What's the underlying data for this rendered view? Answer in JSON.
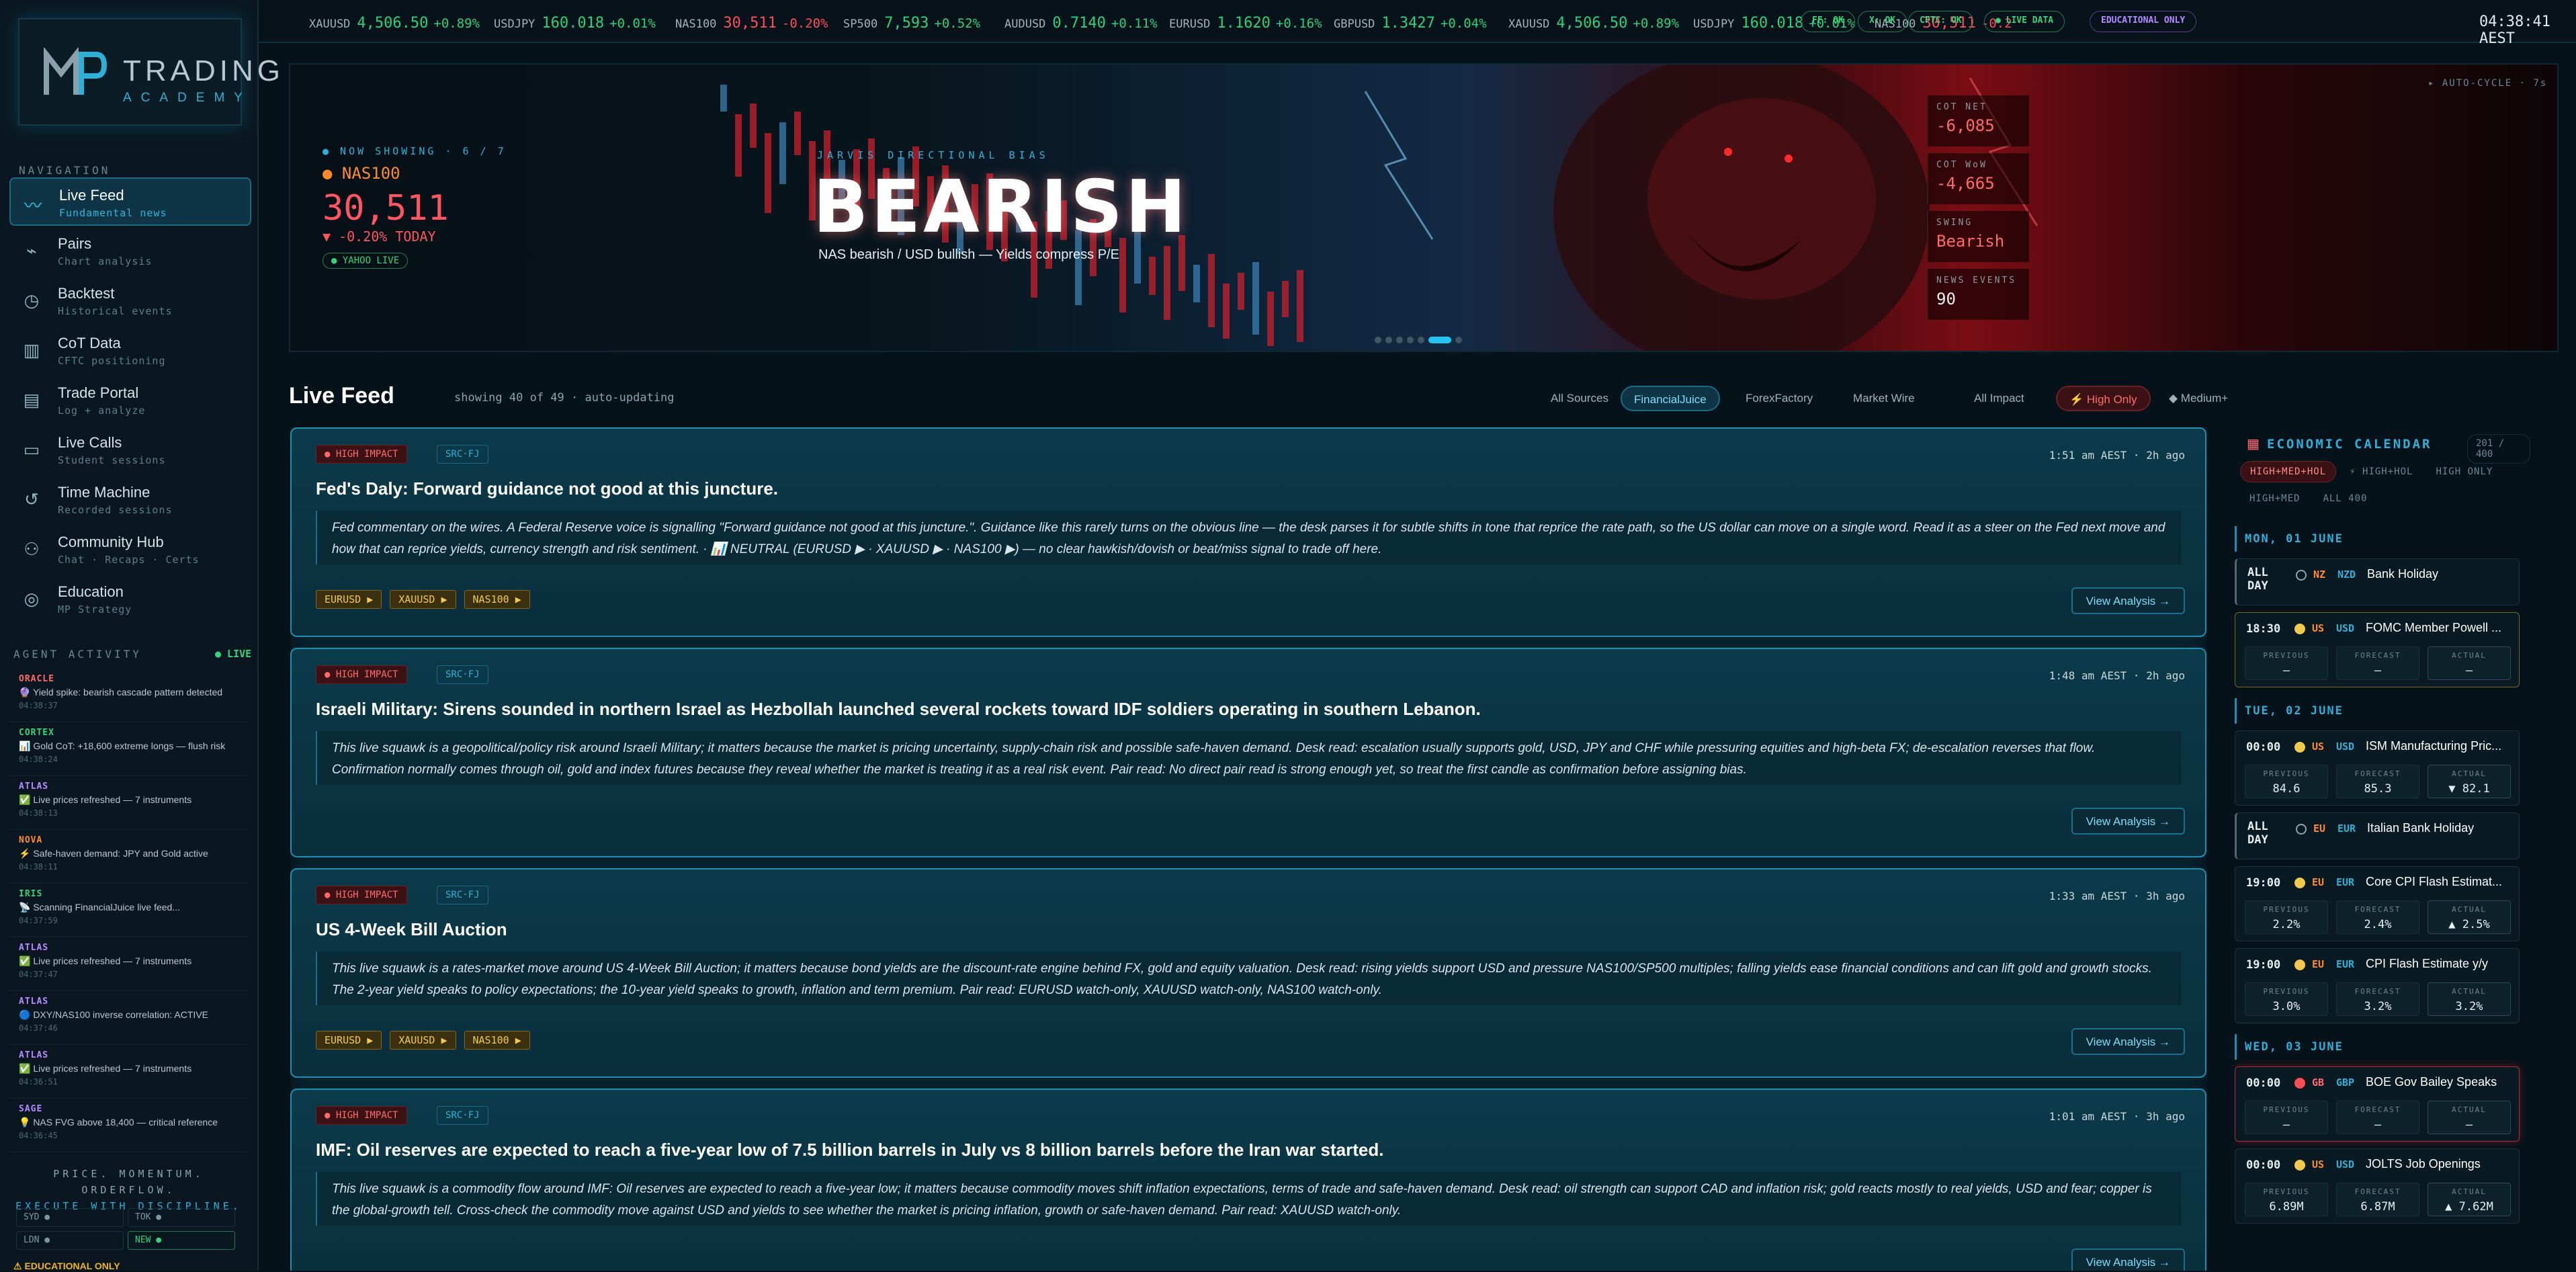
{
  "brand": {
    "name": "TRADING",
    "sub": "ACADEMY"
  },
  "nav": {
    "heading": "NAVIGATION",
    "items": [
      {
        "label": "Live Feed",
        "sub": "Fundamental news",
        "icon": "rss-icon",
        "glyph": "〰"
      },
      {
        "label": "Pairs",
        "sub": "Chart analysis",
        "icon": "chart-icon",
        "glyph": "⌁"
      },
      {
        "label": "Backtest",
        "sub": "Historical events",
        "icon": "clock-icon",
        "glyph": "◷"
      },
      {
        "label": "CoT Data",
        "sub": "CFTC positioning",
        "icon": "bar-chart-icon",
        "glyph": "▥"
      },
      {
        "label": "Trade Portal",
        "sub": "Log + analyze",
        "icon": "document-icon",
        "glyph": "▤"
      },
      {
        "label": "Live Calls",
        "sub": "Student sessions",
        "icon": "video-icon",
        "glyph": "▭"
      },
      {
        "label": "Time Machine",
        "sub": "Recorded sessions",
        "icon": "history-icon",
        "glyph": "↺"
      },
      {
        "label": "Community Hub",
        "sub": "Chat · Recaps · Certs",
        "icon": "users-icon",
        "glyph": "⚇"
      },
      {
        "label": "Education",
        "sub": "MP Strategy",
        "icon": "education-icon",
        "glyph": "◎"
      }
    ]
  },
  "agents": {
    "heading": "AGENT ACTIVITY",
    "live": "● LIVE",
    "items": [
      {
        "name": "ORACLE",
        "color": "#ff6a6a",
        "msg": "🔮 Yield spike: bearish cascade pattern detected",
        "time": "04:38:37"
      },
      {
        "name": "CORTEX",
        "color": "#35d47a",
        "msg": "📊 Gold CoT: +18,600 extreme longs — flush risk",
        "time": "04:38:24"
      },
      {
        "name": "ATLAS",
        "color": "#b48cff",
        "msg": "✅ Live prices refreshed — 7 instruments",
        "time": "04:38:13"
      },
      {
        "name": "NOVA",
        "color": "#ff8c2a",
        "msg": "⚡ Safe-haven demand: JPY and Gold active",
        "time": "04:38:11"
      },
      {
        "name": "IRIS",
        "color": "#35d47a",
        "msg": "📡 Scanning FinancialJuice live feed...",
        "time": "04:37:59"
      },
      {
        "name": "ATLAS",
        "color": "#b48cff",
        "msg": "✅ Live prices refreshed — 7 instruments",
        "time": "04:37:47"
      },
      {
        "name": "ATLAS",
        "color": "#b48cff",
        "msg": "🔵 DXY/NAS100 inverse correlation: ACTIVE",
        "time": "04:37:46"
      },
      {
        "name": "ATLAS",
        "color": "#b48cff",
        "msg": "✅ Live prices refreshed — 7 instruments",
        "time": "04:36:51"
      },
      {
        "name": "SAGE",
        "color": "#b48cff",
        "msg": "💡 NAS FVG above 18,400 — critical reference",
        "time": "04:36:45"
      }
    ]
  },
  "tagline": [
    "PRICE. MOMENTUM. ORDERFLOW.",
    "EXECUTE WITH DISCIPLINE."
  ],
  "markets": [
    {
      "label": "SYD ●",
      "on": false
    },
    {
      "label": "TOK ●",
      "on": false
    },
    {
      "label": "LDN ●",
      "on": false
    },
    {
      "label": "NEW ●",
      "on": true
    }
  ],
  "edu_notice": "⚠ EDUCATIONAL ONLY",
  "ticker": [
    {
      "sym": "XAUUSD",
      "val": "4,506.50",
      "chg": "+0.89%",
      "dir": "up"
    },
    {
      "sym": "USDJPY",
      "val": "160.018",
      "chg": "+0.01%",
      "dir": "up"
    },
    {
      "sym": "NAS100",
      "val": "30,511",
      "chg": "-0.20%",
      "dir": "dn"
    },
    {
      "sym": "SP500",
      "val": "7,593",
      "chg": "+0.52%",
      "dir": "up"
    },
    {
      "sym": "AUDUSD",
      "val": "0.7140",
      "chg": "+0.11%",
      "dir": "up"
    },
    {
      "sym": "EURUSD",
      "val": "1.1620",
      "chg": "+0.16%",
      "dir": "up"
    },
    {
      "sym": "GBPUSD",
      "val": "1.3427",
      "chg": "+0.04%",
      "dir": "up"
    },
    {
      "sym": "XAUUSD",
      "val": "4,506.50",
      "chg": "+0.89%",
      "dir": "up"
    },
    {
      "sym": "USDJPY",
      "val": "160.018",
      "chg": "+0.01%",
      "dir": "up"
    },
    {
      "sym": "NAS100",
      "val": "30,511",
      "chg": "-0.2",
      "dir": "dn"
    }
  ],
  "status": {
    "ff": "FF: OK",
    "x": "X: OK",
    "cftc": "CFTC: OK",
    "live": "● LIVE DATA",
    "edu": "EDUCATIONAL ONLY",
    "clock": "04:38:41 AEST"
  },
  "hero": {
    "now": "● NOW SHOWING · 6 / 7",
    "symbol": "● NAS100",
    "value": "30,511",
    "change": "▼ -0.20% TODAY",
    "source": "● YAHOO LIVE",
    "bias_label": "JARVIS DIRECTIONAL BIAS",
    "bias": "BEARISH",
    "bias_sub": "NAS bearish / USD bullish — Yields compress P/E",
    "auto": "▸ AUTO-CYCLE · 7s",
    "cot": [
      {
        "l": "COT NET",
        "v": "-6,085",
        "red": true
      },
      {
        "l": "COT WoW",
        "v": "-4,665",
        "red": true
      },
      {
        "l": "SWING",
        "v": "Bearish",
        "red": true
      },
      {
        "l": "NEWS EVENTS",
        "v": "90",
        "red": false
      }
    ]
  },
  "feed": {
    "title": "Live Feed",
    "count": "showing 40 of 49 · auto-updating",
    "filters": [
      "All Sources",
      "FinancialJuice",
      "ForexFactory",
      "Market Wire",
      "All Impact",
      "⚡ High Only",
      "◆ Medium+"
    ],
    "cards": [
      {
        "impact": "● HIGH IMPACT",
        "src": "SRC·FJ",
        "time": "1:51 am AEST · 2h ago",
        "title": "Fed's Daly: Forward guidance not good at this juncture.",
        "body": "Fed commentary on the wires. A Federal Reserve voice is signalling \"Forward guidance not good at this juncture.\". Guidance like this rarely turns on the obvious line — the desk parses it for subtle shifts in tone that reprice the rate path, so the US dollar can move on a single word. Read it as a steer on the Fed next move and how that can reprice yields, currency strength and risk sentiment. · 📊 NEUTRAL (EURUSD ▶ · XAUUSD ▶ · NAS100 ▶) — no clear hawkish/dovish or beat/miss signal to trade off here.",
        "pairs": [
          "EURUSD ▶",
          "XAUUSD ▶",
          "NAS100 ▶"
        ],
        "view": "View Analysis →"
      },
      {
        "impact": "● HIGH IMPACT",
        "src": "SRC·FJ",
        "time": "1:48 am AEST · 2h ago",
        "title": "Israeli Military: Sirens sounded in northern Israel as Hezbollah launched several rockets toward IDF soldiers operating in southern Lebanon.",
        "body": "This live squawk is a geopolitical/policy risk around Israeli Military; it matters because the market is pricing uncertainty, supply-chain risk and possible safe-haven demand. Desk read: escalation usually supports gold, USD, JPY and CHF while pressuring equities and high-beta FX; de-escalation reverses that flow. Confirmation normally comes through oil, gold and index futures because they reveal whether the market is treating it as a real risk event. Pair read: No direct pair read is strong enough yet, so treat the first candle as confirmation before assigning bias.",
        "pairs": [],
        "view": "View Analysis →"
      },
      {
        "impact": "● HIGH IMPACT",
        "src": "SRC·FJ",
        "time": "1:33 am AEST · 3h ago",
        "title": "US 4-Week Bill Auction",
        "body": "This live squawk is a rates-market move around US 4-Week Bill Auction; it matters because bond yields are the discount-rate engine behind FX, gold and equity valuation. Desk read: rising yields support USD and pressure NAS100/SP500 multiples; falling yields ease financial conditions and can lift gold and growth stocks. The 2-year yield speaks to policy expectations; the 10-year yield speaks to growth, inflation and term premium. Pair read: EURUSD watch-only, XAUUSD watch-only, NAS100 watch-only.",
        "pairs": [
          "EURUSD ▶",
          "XAUUSD ▶",
          "NAS100 ▶"
        ],
        "view": "View Analysis →"
      },
      {
        "impact": "● HIGH IMPACT",
        "src": "SRC·FJ",
        "time": "1:01 am AEST · 3h ago",
        "title": "IMF: Oil reserves are expected to reach a five-year low of 7.5 billion barrels in July vs 8 billion barrels before the Iran war started.",
        "body": "This live squawk is a commodity flow around IMF: Oil reserves are expected to reach a five-year low; it matters because commodity moves shift inflation expectations, terms of trade and safe-haven demand. Desk read: oil strength can support CAD and inflation risk; gold reacts mostly to real yields, USD and fear; copper is the global-growth tell. Cross-check the commodity move against USD and yields to see whether the market is pricing inflation, growth or safe-haven demand. Pair read: XAUUSD watch-only.",
        "pairs": [],
        "view": "View Analysis →"
      }
    ]
  },
  "calendar": {
    "title": "ECONOMIC CALENDAR",
    "count": "201 / 400",
    "filters": [
      "HIGH+MED+HOL",
      "⚡ HIGH+HOL",
      "HIGH ONLY",
      "HIGH+MED",
      "ALL 400"
    ],
    "days": [
      {
        "label": "MON, 01 JUNE",
        "events": [
          {
            "time": "ALL DAY",
            "cc": "NZ",
            "cur": "NZD",
            "name": "Bank Holiday",
            "type": "hol"
          },
          {
            "time": "18:30",
            "cc": "US",
            "cur": "USD",
            "name": "FOMC Member Powell ...",
            "type": "med",
            "prev": "—",
            "fc": "—",
            "act": "—"
          }
        ]
      },
      {
        "label": "TUE, 02 JUNE",
        "events": [
          {
            "time": "00:00",
            "cc": "US",
            "cur": "USD",
            "name": "ISM Manufacturing Pric...",
            "type": "med",
            "prev": "84.6",
            "fc": "85.3",
            "act": "▼ 82.1",
            "actc": "dn"
          },
          {
            "time": "ALL DAY",
            "cc": "EU",
            "cur": "EUR",
            "name": "Italian Bank Holiday",
            "type": "hol"
          },
          {
            "time": "19:00",
            "cc": "EU",
            "cur": "EUR",
            "name": "Core CPI Flash Estimat...",
            "type": "med",
            "prev": "2.2%",
            "fc": "2.4%",
            "act": "▲ 2.5%",
            "actc": "up"
          },
          {
            "time": "19:00",
            "cc": "EU",
            "cur": "EUR",
            "name": "CPI Flash Estimate y/y",
            "type": "med",
            "prev": "3.0%",
            "fc": "3.2%",
            "act": "3.2%",
            "actc": ""
          }
        ]
      },
      {
        "label": "WED, 03 JUNE",
        "events": [
          {
            "time": "00:00",
            "cc": "GB",
            "cur": "GBP",
            "name": "BOE Gov Bailey Speaks",
            "type": "high",
            "prev": "—",
            "fc": "—",
            "act": "—"
          },
          {
            "time": "00:00",
            "cc": "US",
            "cur": "USD",
            "name": "JOLTS Job Openings",
            "type": "med",
            "prev": "6.89M",
            "fc": "6.87M",
            "act": "▲ 7.62M",
            "actc": "up"
          }
        ]
      }
    ],
    "labels": {
      "prev": "PREVIOUS",
      "fc": "FORECAST",
      "act": "ACTUAL"
    }
  },
  "colors": {
    "accent": "#2fb0d8",
    "up": "#27d37c",
    "down": "#ff4c57",
    "gold": "#f2c94c"
  }
}
